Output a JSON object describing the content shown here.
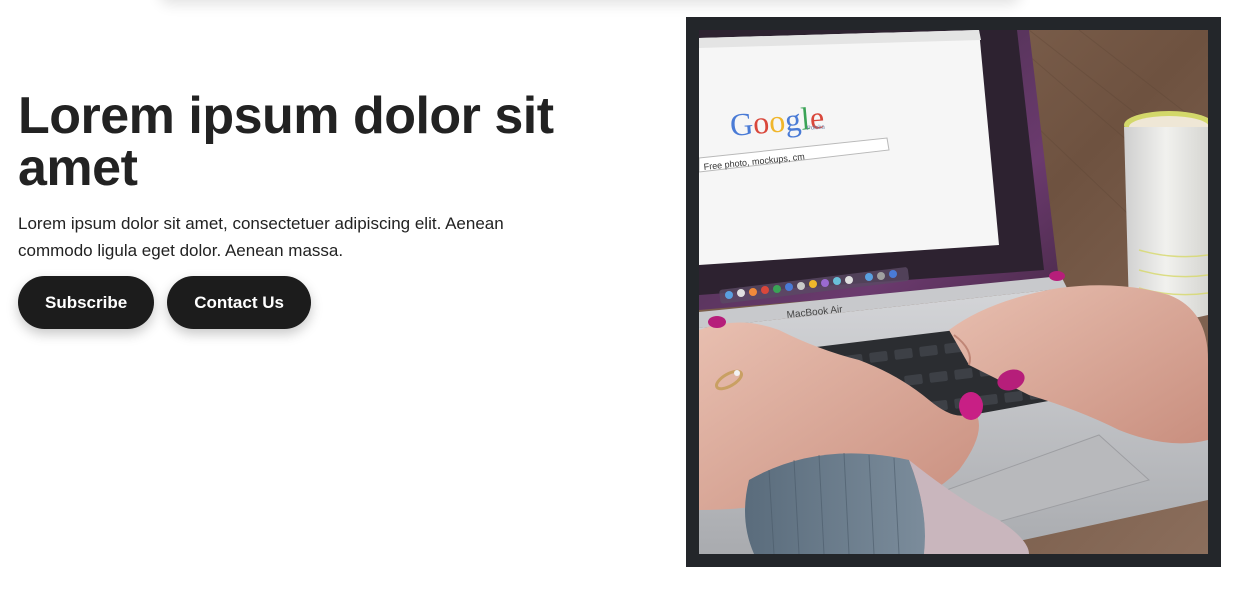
{
  "hero": {
    "title": "Lorem ipsum dolor sit amet",
    "description": "Lorem ipsum dolor sit amet, consectetuer adipiscing elit. Aenean commodo ligula eget dolor. Aenean massa.",
    "buttons": {
      "subscribe": "Subscribe",
      "contact": "Contact Us"
    }
  },
  "image": {
    "screen_logo": "Google",
    "screen_logo_sub": "Polska",
    "search_text": "Free photo, mockups, cm",
    "laptop_label": "MacBook Air"
  },
  "colors": {
    "button_bg": "#1c1c1c",
    "frame": "#23262a",
    "text": "#222222"
  }
}
